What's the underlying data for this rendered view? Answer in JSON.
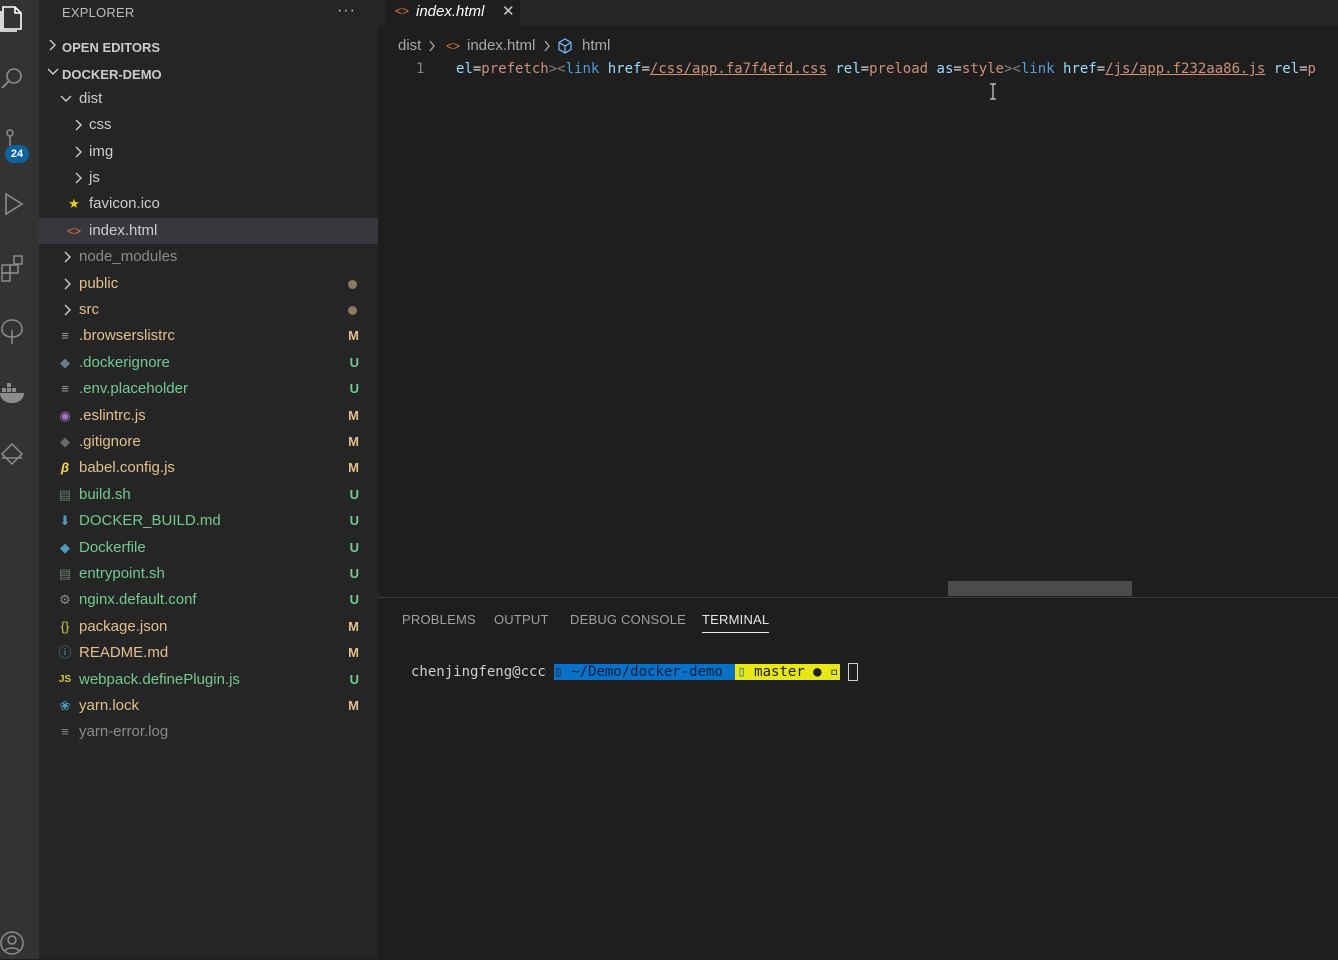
{
  "activity_bar": {
    "icons": [
      "explorer-icon",
      "search-icon",
      "source-control-icon",
      "run-debug-icon",
      "extensions-icon",
      "tree-icon",
      "docker-icon",
      "remote-icon",
      "account-icon"
    ],
    "scm_badge": "24"
  },
  "sidebar": {
    "title": "EXPLORER",
    "more": "···",
    "sections": {
      "open_editors": "OPEN EDITORS",
      "project": "DOCKER-DEMO"
    },
    "tree": [
      {
        "name": "dist",
        "status": ""
      },
      {
        "name": "css",
        "status": ""
      },
      {
        "name": "img",
        "status": ""
      },
      {
        "name": "js",
        "status": ""
      },
      {
        "name": "favicon.ico",
        "status": ""
      },
      {
        "name": "index.html",
        "status": ""
      },
      {
        "name": "node_modules",
        "status": ""
      },
      {
        "name": "public",
        "status": ""
      },
      {
        "name": "src",
        "status": ""
      },
      {
        "name": ".browserslistrc",
        "status": "M"
      },
      {
        "name": ".dockerignore",
        "status": "U"
      },
      {
        "name": ".env.placeholder",
        "status": "U"
      },
      {
        "name": ".eslintrc.js",
        "status": "M"
      },
      {
        "name": ".gitignore",
        "status": "M"
      },
      {
        "name": "babel.config.js",
        "status": "M"
      },
      {
        "name": "build.sh",
        "status": "U"
      },
      {
        "name": "DOCKER_BUILD.md",
        "status": "U"
      },
      {
        "name": "Dockerfile",
        "status": "U"
      },
      {
        "name": "entrypoint.sh",
        "status": "U"
      },
      {
        "name": "nginx.default.conf",
        "status": "U"
      },
      {
        "name": "package.json",
        "status": "M"
      },
      {
        "name": "README.md",
        "status": "M"
      },
      {
        "name": "webpack.definePlugin.js",
        "status": "U"
      },
      {
        "name": "yarn.lock",
        "status": "M"
      },
      {
        "name": "yarn-error.log",
        "status": ""
      }
    ]
  },
  "editor": {
    "tab": {
      "label": "index.html",
      "close": "✕"
    },
    "breadcrumb": {
      "folder": "dist",
      "file": "index.html",
      "symbol": "html"
    },
    "line_number": "1",
    "code": {
      "t1": "el",
      "t2": "=",
      "t3": "prefetch",
      "t4": "><",
      "t5": "link",
      "t6": "href",
      "t7": "=",
      "t8": "/css/app.fa7f4efd.css",
      "t9": "rel",
      "t10": "=",
      "t11": "preload",
      "t12": "as",
      "t13": "=",
      "t14": "style",
      "t15": "><",
      "t16": "link",
      "t17": "href",
      "t18": "=",
      "t19": "/js/app.f232aa86.js",
      "t20": "rel",
      "t21": "=",
      "t22": "p"
    }
  },
  "panel": {
    "tabs": [
      "PROBLEMS",
      "OUTPUT",
      "DEBUG CONSOLE",
      "TERMINAL"
    ],
    "terminal": {
      "user": "chenjingfeng@ccc",
      "path": " ~/Demo/docker-demo ",
      "branch": " master ● "
    }
  },
  "colors": {
    "modified": "#e2c08d",
    "untracked": "#73c991",
    "accent_blue": "#0a71c9",
    "accent_yellow": "#e8e817"
  }
}
